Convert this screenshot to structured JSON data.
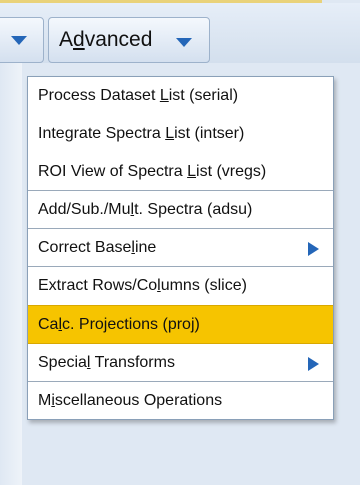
{
  "toolbar": {
    "menu_title": {
      "pre": "A",
      "mnemonic": "d",
      "post": "vanced"
    }
  },
  "menu": {
    "items": [
      {
        "pre": "Process Dataset ",
        "mnemonic": "L",
        "post": "ist (serial)",
        "submenu": false,
        "highlighted": false
      },
      {
        "pre": "Integrate Spectra ",
        "mnemonic": "L",
        "post": "ist (intser)",
        "submenu": false,
        "highlighted": false
      },
      {
        "pre": "ROI View of Spectra ",
        "mnemonic": "L",
        "post": "ist (vregs)",
        "submenu": false,
        "highlighted": false
      },
      {
        "pre": "Add/Sub./Mu",
        "mnemonic": "l",
        "post": "t. Spectra (adsu)",
        "submenu": false,
        "highlighted": false
      },
      {
        "pre": "Correct Base",
        "mnemonic": "l",
        "post": "ine",
        "submenu": true,
        "highlighted": false
      },
      {
        "pre": "Extract Rows/Co",
        "mnemonic": "l",
        "post": "umns (slice)",
        "submenu": false,
        "highlighted": false
      },
      {
        "pre": "Ca",
        "mnemonic": "l",
        "post": "c. Projections (proj)",
        "submenu": false,
        "highlighted": true
      },
      {
        "pre": "Specia",
        "mnemonic": "l",
        "post": " Transforms",
        "submenu": true,
        "highlighted": false
      },
      {
        "pre": "M",
        "mnemonic": "i",
        "post": "scellaneous Operations",
        "submenu": false,
        "highlighted": false
      }
    ]
  },
  "colors": {
    "highlight": "#f6c400",
    "accent_arrow": "#2466b8"
  }
}
